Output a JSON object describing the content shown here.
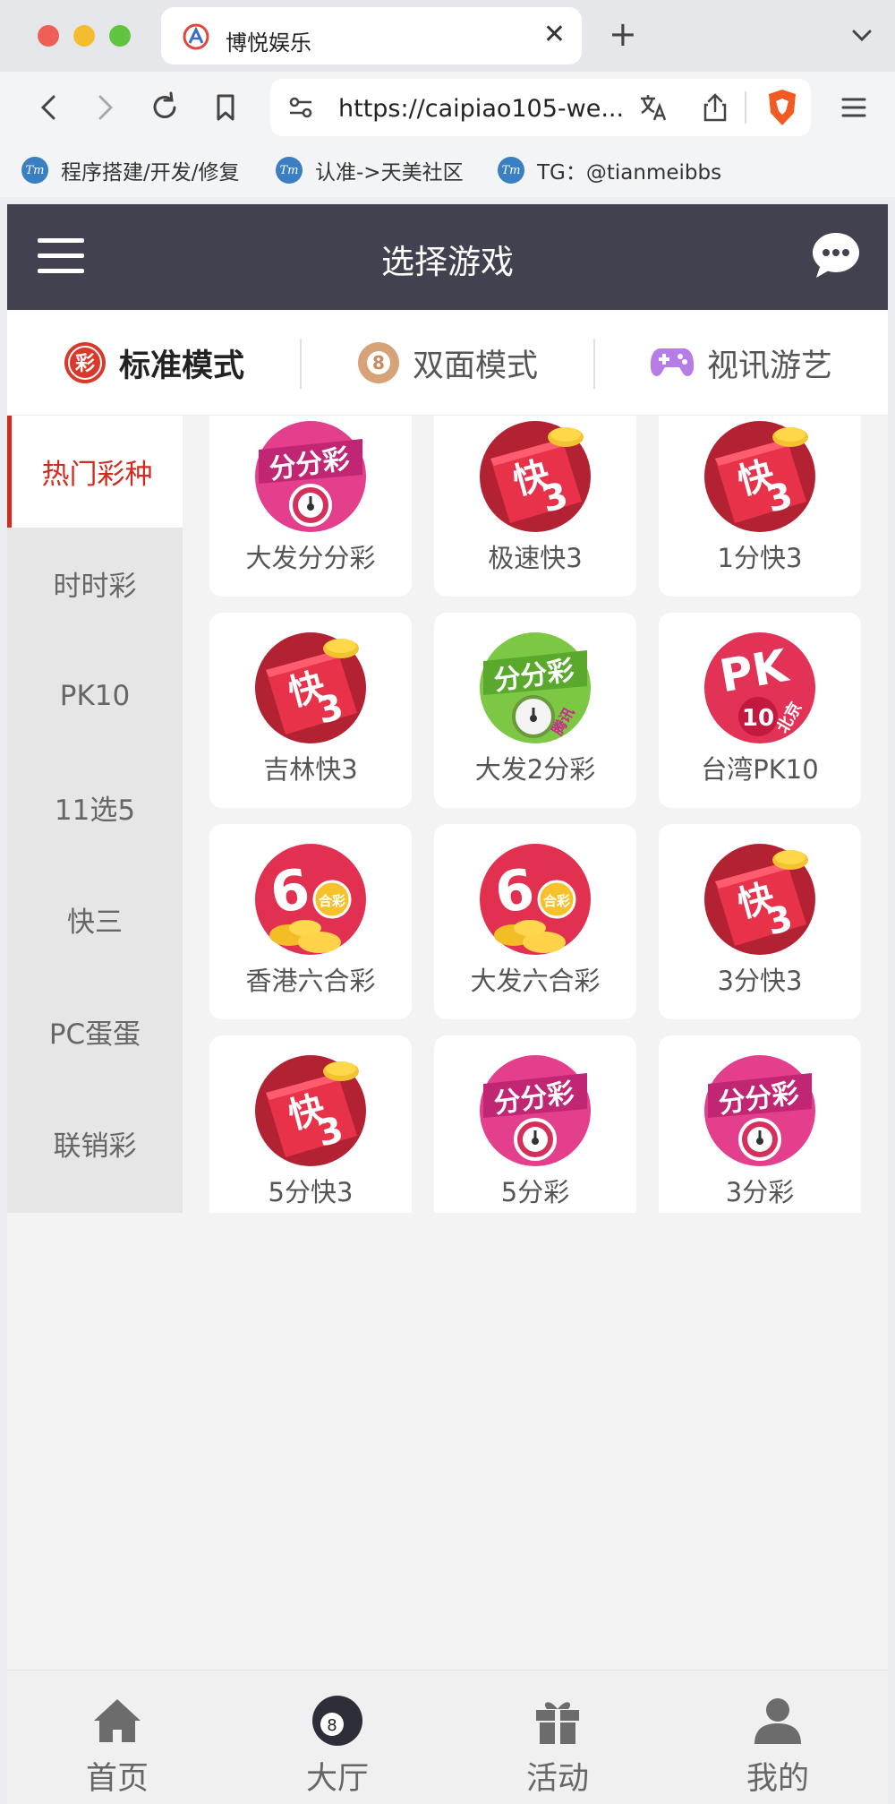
{
  "browser": {
    "tab_title": "博悦娱乐",
    "tab_close": "✕",
    "new_tab": "+",
    "url": "https://caipiao105-we...",
    "bookmarks": [
      {
        "label": "程序搭建/开发/修复"
      },
      {
        "label": "认准->天美社区"
      },
      {
        "label": "TG：@tianmeibbs"
      }
    ],
    "bookmark_icon_text": "Tm"
  },
  "header": {
    "title": "选择游戏"
  },
  "modes": [
    {
      "label": "标准模式",
      "icon": "cai-icon",
      "active": true
    },
    {
      "label": "双面模式",
      "icon": "eight-ball-icon",
      "active": false
    },
    {
      "label": "视讯游艺",
      "icon": "gamepad-icon",
      "active": false
    }
  ],
  "mode_icon_text": {
    "cai": "彩",
    "eight": "8"
  },
  "sidebar": {
    "items": [
      {
        "label": "热门彩种",
        "active": true
      },
      {
        "label": "时时彩"
      },
      {
        "label": "PK10"
      },
      {
        "label": "11选5"
      },
      {
        "label": "快三"
      },
      {
        "label": "PC蛋蛋"
      },
      {
        "label": "联销彩"
      }
    ]
  },
  "games": [
    {
      "label": "大发分分彩",
      "icon": "fenfencai-icon"
    },
    {
      "label": "极速快3",
      "icon": "kuai3-icon"
    },
    {
      "label": "1分快3",
      "icon": "kuai3-icon"
    },
    {
      "label": "吉林快3",
      "icon": "kuai3-icon"
    },
    {
      "label": "大发2分彩",
      "icon": "fenfencai-tengxun-icon"
    },
    {
      "label": "台湾PK10",
      "icon": "pk10-icon"
    },
    {
      "label": "香港六合彩",
      "icon": "liuhecai-icon"
    },
    {
      "label": "大发六合彩",
      "icon": "liuhecai-icon"
    },
    {
      "label": "3分快3",
      "icon": "kuai3-icon"
    },
    {
      "label": "5分快3",
      "icon": "kuai3-icon"
    },
    {
      "label": "5分彩",
      "icon": "fenfencai-icon"
    },
    {
      "label": "3分彩",
      "icon": "fenfencai-icon"
    }
  ],
  "icon_text": {
    "kuai": "快",
    "three": "3",
    "fenfencai": "分分彩",
    "tengxun": "腾讯",
    "pk": "PK",
    "ten": "10",
    "beijing": "北京",
    "six": "6",
    "hecai": "合彩"
  },
  "tabbar": {
    "items": [
      {
        "label": "首页",
        "icon": "home-icon"
      },
      {
        "label": "大厅",
        "icon": "eight-ball-icon"
      },
      {
        "label": "活动",
        "icon": "gift-icon"
      },
      {
        "label": "我的",
        "icon": "user-icon"
      }
    ]
  },
  "colors": {
    "header_bg": "#42414f",
    "accent_red": "#cf2b1f",
    "sidebar_bg": "#e6e6e6"
  }
}
